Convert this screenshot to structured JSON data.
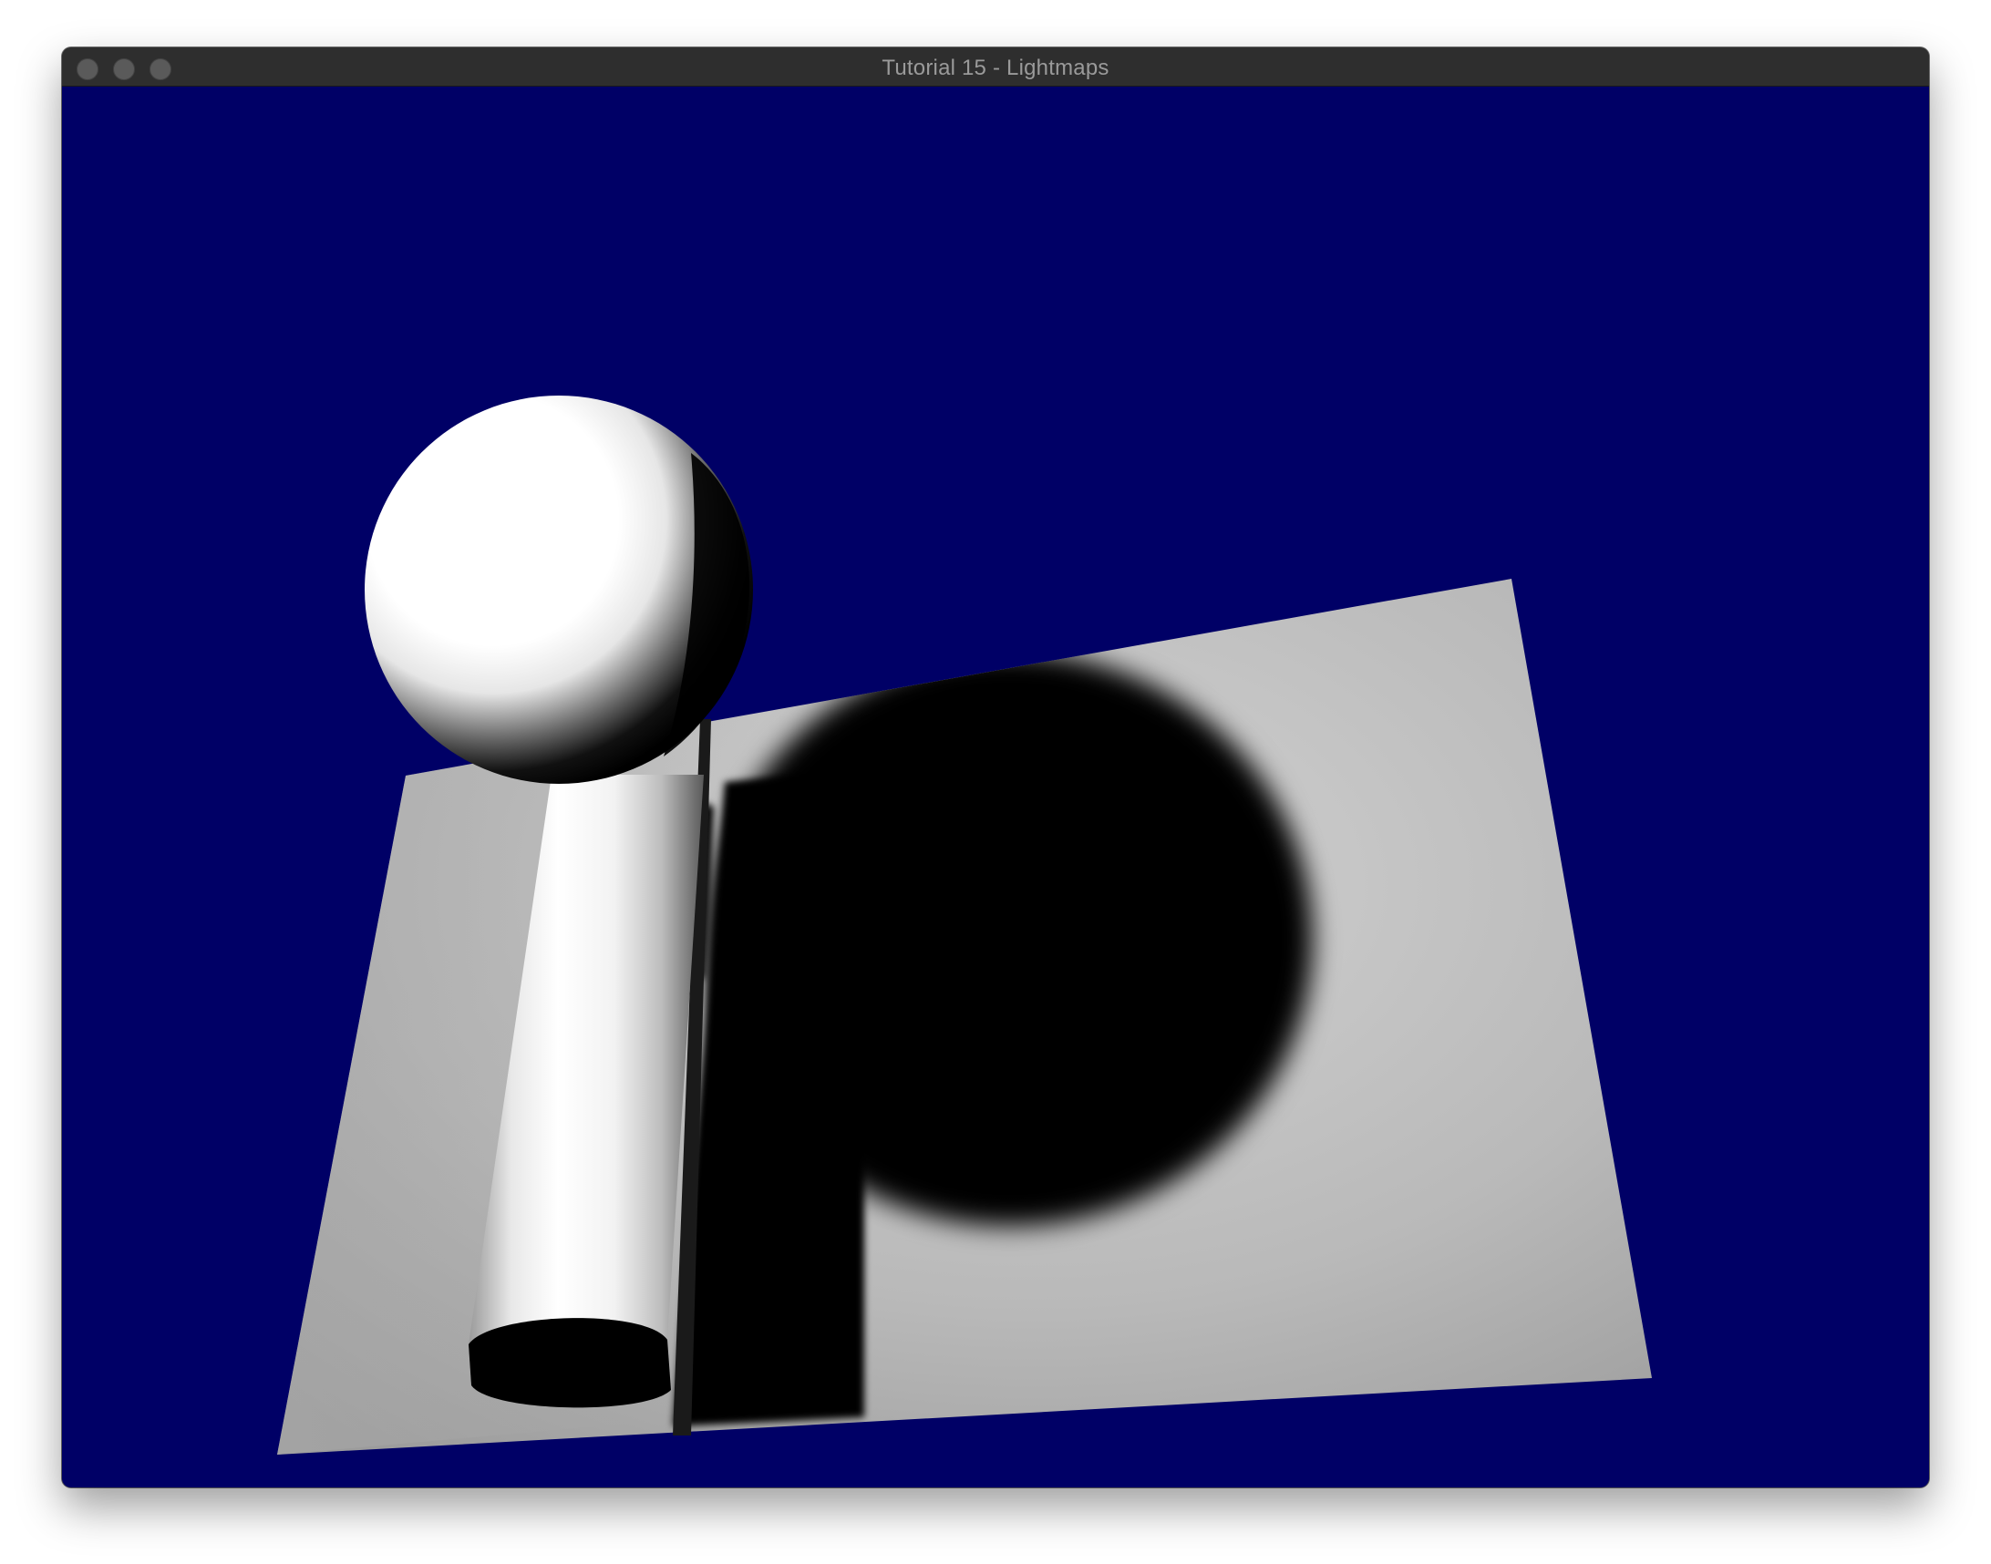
{
  "window": {
    "title": "Tutorial 15 - Lightmaps",
    "controls": [
      "close-button",
      "minimize-button",
      "zoom-button"
    ]
  },
  "scene": {
    "clear_color": "#000066",
    "objects": [
      "plane",
      "sphere",
      "cylinder",
      "sphere-shadow",
      "cylinder-shadow"
    ],
    "plane_color": "#b8b8b8",
    "object_color": "#ffffff",
    "shadow_color": "#000000"
  }
}
